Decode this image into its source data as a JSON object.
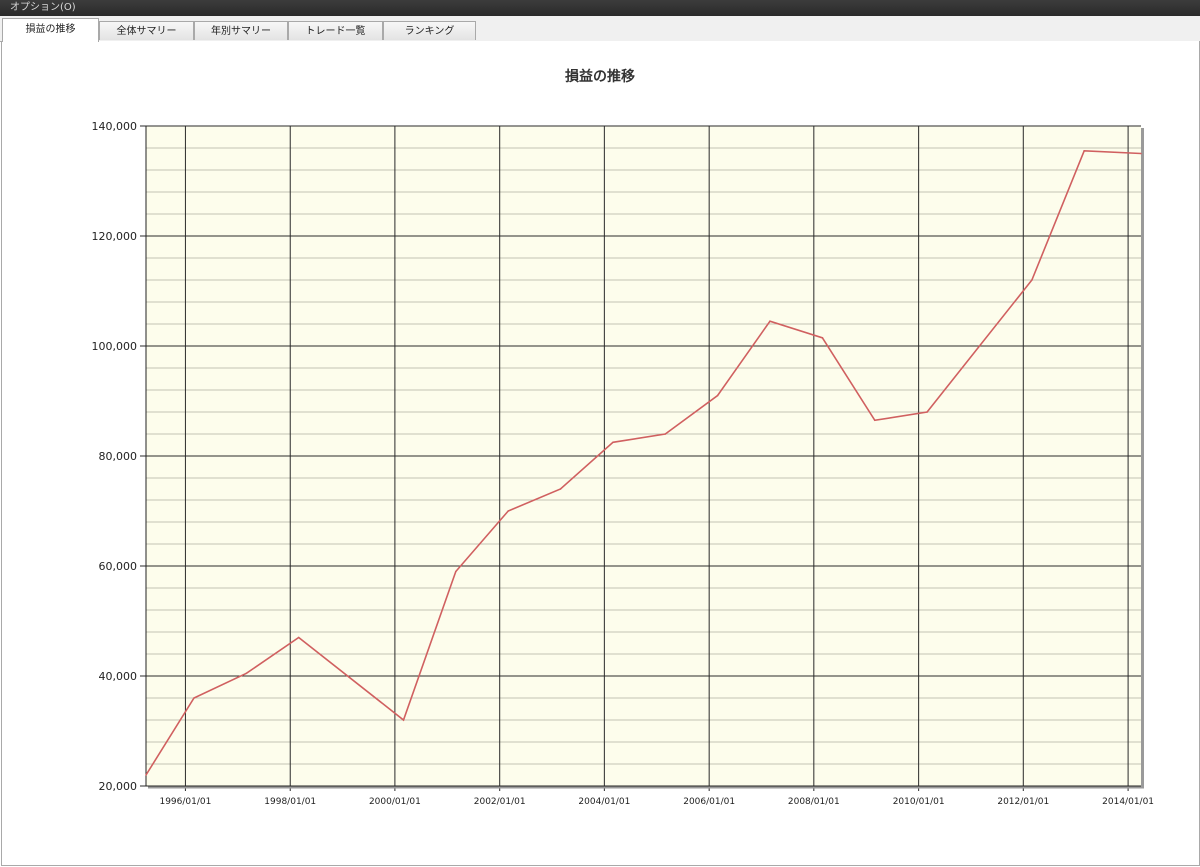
{
  "menubar": {
    "options_label": "オプション(O)"
  },
  "tabs": [
    {
      "label": "損益の推移",
      "active": true
    },
    {
      "label": "全体サマリー",
      "active": false
    },
    {
      "label": "年別サマリー",
      "active": false
    },
    {
      "label": "トレード一覧",
      "active": false
    },
    {
      "label": "ランキング",
      "active": false
    }
  ],
  "colors": {
    "plot_background": "#fdfdec",
    "line": "#d06060",
    "major_grid": "#2a2a2a",
    "minor_grid": "#c4c4b4"
  },
  "chart_data": {
    "type": "line",
    "title": "損益の推移",
    "xlabel": "",
    "ylabel": "",
    "x_ticks": [
      "1996/01/01",
      "1998/01/01",
      "2000/01/01",
      "2002/01/01",
      "2004/01/01",
      "2006/01/01",
      "2008/01/01",
      "2010/01/01",
      "2012/01/01",
      "2014/01/01"
    ],
    "y_ticks": [
      "20,000",
      "40,000",
      "60,000",
      "80,000",
      "100,000",
      "120,000",
      "140,000"
    ],
    "ylim": [
      20000,
      140000
    ],
    "xlim": [
      "1995/04/01",
      "2014/04/01"
    ],
    "grid": true,
    "series": [
      {
        "x": [
          "1995/04/01",
          "1996/03/01",
          "1997/03/01",
          "1998/03/01",
          "2000/03/01",
          "2001/03/01",
          "2002/03/01",
          "2003/03/01",
          "2004/03/01",
          "2005/03/01",
          "2006/03/01",
          "2007/03/01",
          "2008/03/01",
          "2009/03/01",
          "2010/03/01",
          "2012/03/01",
          "2013/03/01",
          "2014/04/01"
        ],
        "values": [
          22000,
          36000,
          40500,
          47000,
          32000,
          59000,
          70000,
          74000,
          82500,
          84000,
          91000,
          104500,
          101500,
          86500,
          88000,
          112000,
          135500,
          135000
        ]
      }
    ]
  }
}
